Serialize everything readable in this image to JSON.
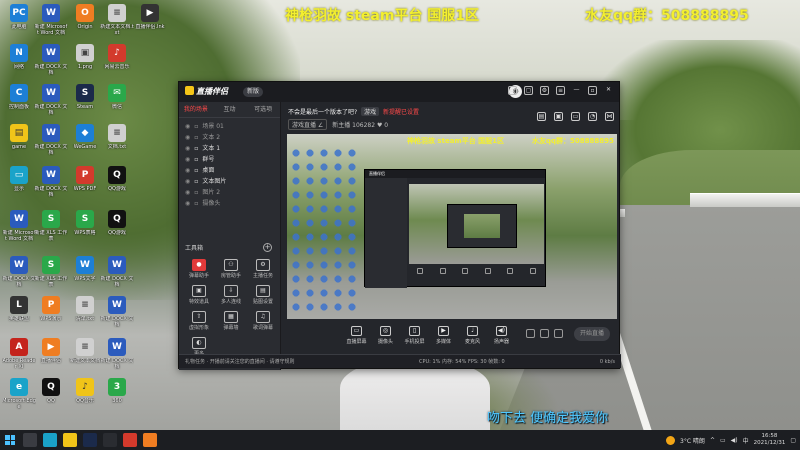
{
  "banner": {
    "left": "神枪羽故 steam平台 国服1区",
    "right": "水友qq群：508888895"
  },
  "desktop_icons": [
    {
      "label": "此电脑",
      "glyph": "PC",
      "cls": "g-blue"
    },
    {
      "label": "新建 Microsoft Word 文档",
      "glyph": "W",
      "cls": "g-word"
    },
    {
      "label": "Origin",
      "glyph": "O",
      "cls": "g-orange"
    },
    {
      "label": "新建文本文档.txt",
      "glyph": "≡",
      "cls": "g-exe"
    },
    {
      "label": "直播伴侣.lnk",
      "glyph": "▶",
      "cls": "g-dark"
    },
    {
      "label": "网络",
      "glyph": "N",
      "cls": "g-blue"
    },
    {
      "label": "新建 DOCX 文档",
      "glyph": "W",
      "cls": "g-word"
    },
    {
      "label": "1.png",
      "glyph": "▣",
      "cls": "g-exe"
    },
    {
      "label": "网易云音乐",
      "glyph": "♪",
      "cls": "g-red"
    },
    {
      "label": "控制面板",
      "glyph": "C",
      "cls": "g-blue"
    },
    {
      "label": "新建 DOCX 文档",
      "glyph": "W",
      "cls": "g-word"
    },
    {
      "label": "Steam",
      "glyph": "S",
      "cls": "g-steam"
    },
    {
      "label": "微信",
      "glyph": "✉",
      "cls": "g-green"
    },
    {
      "label": "game",
      "glyph": "▤",
      "cls": "g-yellow"
    },
    {
      "label": "新建 DOCX 文档",
      "glyph": "W",
      "cls": "g-word"
    },
    {
      "label": "WeGame",
      "glyph": "◆",
      "cls": "g-blue"
    },
    {
      "label": "文档.txt",
      "glyph": "≡",
      "cls": "g-exe"
    },
    {
      "label": "显示",
      "glyph": "▭",
      "cls": "g-cyan"
    },
    {
      "label": "新建 DOCX 文档",
      "glyph": "W",
      "cls": "g-word"
    },
    {
      "label": "WPS PDF",
      "glyph": "P",
      "cls": "g-red"
    },
    {
      "label": "QQ游戏",
      "glyph": "Q",
      "cls": "g-qq"
    },
    {
      "label": "新建 Microsoft Word 文档",
      "glyph": "W",
      "cls": "g-word"
    },
    {
      "label": "新建 XLS 工作表",
      "glyph": "S",
      "cls": "g-green"
    },
    {
      "label": "WPS表格",
      "glyph": "S",
      "cls": "g-green"
    },
    {
      "label": "QQ游戏",
      "glyph": "Q",
      "cls": "g-qq"
    },
    {
      "label": "新建 DOCX 文档",
      "glyph": "W",
      "cls": "g-word"
    },
    {
      "label": "新建 XLS 工作表",
      "glyph": "S",
      "cls": "g-green"
    },
    {
      "label": "WPS文字",
      "glyph": "W",
      "cls": "g-blue"
    },
    {
      "label": "新建 DOCX 文档",
      "glyph": "W",
      "cls": "g-word"
    },
    {
      "label": "英雄联盟",
      "glyph": "L",
      "cls": "g-dark"
    },
    {
      "label": "WPS演示",
      "glyph": "P",
      "cls": "g-orange"
    },
    {
      "label": "清单.txt",
      "glyph": "≡",
      "cls": "g-exe"
    },
    {
      "label": "新建 DOCX 文档",
      "glyph": "W",
      "cls": "g-word"
    },
    {
      "label": "Adobe Reader XI",
      "glyph": "A",
      "cls": "g-pdf"
    },
    {
      "label": "直播伴侣",
      "glyph": "▶",
      "cls": "g-orange"
    },
    {
      "label": "新建文本文档",
      "glyph": "≡",
      "cls": "g-exe"
    },
    {
      "label": "新建 DOCX 文档",
      "glyph": "W",
      "cls": "g-word"
    },
    {
      "label": "Microsoft Edge",
      "glyph": "e",
      "cls": "g-cyan"
    },
    {
      "label": "QQ",
      "glyph": "Q",
      "cls": "g-qq"
    },
    {
      "label": "QQ音乐",
      "glyph": "♪",
      "cls": "g-yellow"
    },
    {
      "label": "360",
      "glyph": "3",
      "cls": "g-green"
    },
    {
      "label": "PotPlayer",
      "glyph": "▶",
      "cls": "g-cyan"
    }
  ],
  "app": {
    "logo": "直播伴侣",
    "version_badge": "新版",
    "left_tabs": [
      "我的场景",
      "互动",
      "可选项"
    ],
    "scene_items": [
      "场景 01",
      "文本 2",
      "文本 1",
      "群号",
      "桌面",
      "文本图片",
      "图片 2",
      "摄像头"
    ],
    "tools_title": "工具箱",
    "tools": [
      {
        "icon": "●",
        "label": "弹幕助手",
        "red": true
      },
      {
        "icon": "⚇",
        "label": "房管助手",
        "red": false
      },
      {
        "icon": "⚙",
        "label": "主播任务",
        "red": false
      },
      {
        "icon": "▣",
        "label": "特效道具",
        "red": false
      },
      {
        "icon": "⇩",
        "label": "多人连线",
        "red": false
      },
      {
        "icon": "▤",
        "label": "贴图设置",
        "red": false
      },
      {
        "icon": "⇧",
        "label": "虚拟形象",
        "red": false
      },
      {
        "icon": "▦",
        "label": "弹幕墙",
        "red": false
      },
      {
        "icon": "♫",
        "label": "歌词弹幕",
        "red": false
      },
      {
        "icon": "◐",
        "label": "更多",
        "red": false
      }
    ],
    "stream_title": "不会是最后一个版本了吧?",
    "tag1": "游戏",
    "hot_text": "新提醒已设置",
    "category_label": "游戏直播 ∠",
    "fans_text": "新主播 106282",
    "likes_text": "0",
    "preview_banner_left": "神枪羽故 steam平台 国服1区",
    "preview_banner_right": "水友qq群：508888895",
    "inner_title": "直播伴侣",
    "controls": [
      {
        "icon": "▭",
        "label": "直播屏幕"
      },
      {
        "icon": "◎",
        "label": "摄像头"
      },
      {
        "icon": "▯",
        "label": "手机投屏"
      },
      {
        "icon": "▶",
        "label": "多媒体"
      },
      {
        "icon": "♩",
        "label": "麦克风"
      },
      {
        "icon": "◀)",
        "label": "扬声器"
      }
    ],
    "start_live": "开始直播",
    "status_left": "礼物任务 · 开播前请关注您的直播间 · 请遵守规则",
    "status_stats": "CPU: 1%   内存: 54%   FPS: 30   帧数: 0",
    "status_rate": "0 kb/s"
  },
  "subtitle": "吻下去 便确定我爱你",
  "taskbar": {
    "weather": "3°C 晴朗",
    "time": "16:58",
    "date": "2021/12/31"
  }
}
